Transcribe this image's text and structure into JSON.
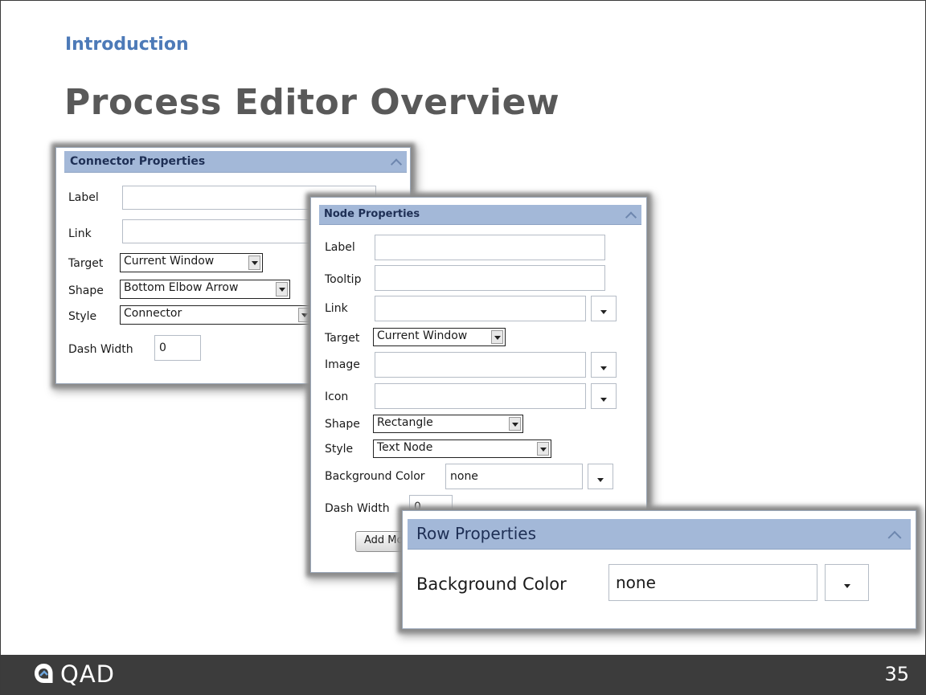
{
  "slide": {
    "section": "Introduction",
    "title": "Process Editor Overview",
    "page_number": "35",
    "brand": "QAD"
  },
  "connector_panel": {
    "header": "Connector Properties",
    "label_label": "Label",
    "label_value": "",
    "link_label": "Link",
    "link_value": "",
    "target_label": "Target",
    "target_value": "Current Window",
    "shape_label": "Shape",
    "shape_value": "Bottom Elbow Arrow",
    "style_label": "Style",
    "style_value": "Connector",
    "dash_width_label": "Dash Width",
    "dash_width_value": "0"
  },
  "node_panel": {
    "header": "Node Properties",
    "label_label": "Label",
    "label_value": "",
    "tooltip_label": "Tooltip",
    "tooltip_value": "",
    "link_label": "Link",
    "link_value": "",
    "target_label": "Target",
    "target_value": "Current Window",
    "image_label": "Image",
    "image_value": "",
    "icon_label": "Icon",
    "icon_value": "",
    "shape_label": "Shape",
    "shape_value": "Rectangle",
    "style_label": "Style",
    "style_value": "Text Node",
    "bg_color_label": "Background Color",
    "bg_color_value": "none",
    "dash_width_label": "Dash Width",
    "dash_width_value": "0",
    "add_button_label": "Add Mo"
  },
  "row_panel": {
    "header": "Row Properties",
    "bg_color_label": "Background Color",
    "bg_color_value": "none"
  },
  "colors": {
    "section_text": "#4d7ab8",
    "title_text": "#595959",
    "panel_header_bg": "#a3b8d8",
    "footer_bg": "#3c3c3c"
  },
  "icons": [
    "chevron-up-icon",
    "dropdown-arrow-icon",
    "qad-logo-icon"
  ]
}
